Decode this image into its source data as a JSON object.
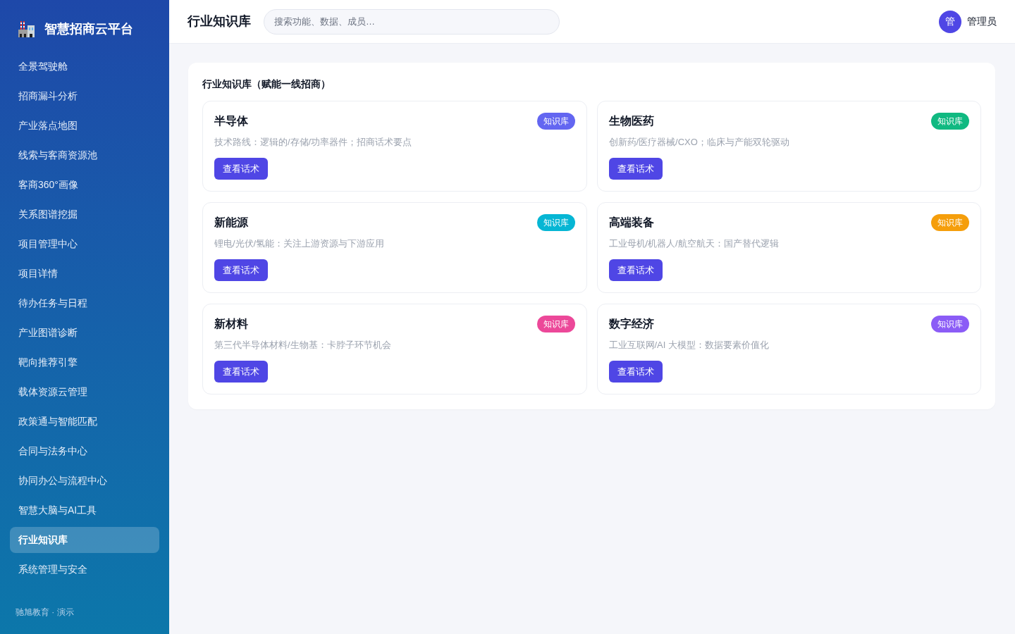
{
  "sidebar": {
    "logo_text": "智慧招商云平台",
    "items": [
      {
        "label": "全景驾驶舱",
        "selected": false
      },
      {
        "label": "招商漏斗分析",
        "selected": false
      },
      {
        "label": "产业落点地图",
        "selected": false
      },
      {
        "label": "线索与客商资源池",
        "selected": false
      },
      {
        "label": "客商360°画像",
        "selected": false
      },
      {
        "label": "关系图谱挖掘",
        "selected": false
      },
      {
        "label": "项目管理中心",
        "selected": false
      },
      {
        "label": "项目详情",
        "selected": false
      },
      {
        "label": "待办任务与日程",
        "selected": false
      },
      {
        "label": "产业图谱诊断",
        "selected": false
      },
      {
        "label": "靶向推荐引擎",
        "selected": false
      },
      {
        "label": "载体资源云管理",
        "selected": false
      },
      {
        "label": "政策通与智能匹配",
        "selected": false
      },
      {
        "label": "合同与法务中心",
        "selected": false
      },
      {
        "label": "协同办公与流程中心",
        "selected": false
      },
      {
        "label": "智慧大脑与AI工具",
        "selected": false
      },
      {
        "label": "行业知识库",
        "selected": true
      },
      {
        "label": "系统管理与安全",
        "selected": false
      }
    ],
    "footer": "驰旭教育 · 演示"
  },
  "header": {
    "title": "行业知识库",
    "search": {
      "placeholder": "搜索功能、数据、成员…"
    },
    "user": {
      "avatar": "管",
      "name": "管理员"
    }
  },
  "panel": {
    "title": "行业知识库（赋能一线招商）",
    "cards": [
      {
        "title": "半导体",
        "badge": "知识库",
        "color": "#6366f1",
        "description": "技术路线：逻辑的/存储/功率器件；招商话术要点",
        "button": "查看话术"
      },
      {
        "title": "生物医药",
        "badge": "知识库",
        "color": "#10b981",
        "description": "创新药/医疗器械/CXO；临床与产能双轮驱动",
        "button": "查看话术"
      },
      {
        "title": "新能源",
        "badge": "知识库",
        "color": "#06b6d4",
        "description": "锂电/光伏/氢能：关注上游资源与下游应用",
        "button": "查看话术"
      },
      {
        "title": "高端装备",
        "badge": "知识库",
        "color": "#f59e0b",
        "description": "工业母机/机器人/航空航天：国产替代逻辑",
        "button": "查看话术"
      },
      {
        "title": "新材料",
        "badge": "知识库",
        "color": "#ec4899",
        "description": "第三代半导体材料/生物基：卡脖子环节机会",
        "button": "查看话术"
      },
      {
        "title": "数字经济",
        "badge": "知识库",
        "color": "#8b5cf6",
        "description": "工业互联网/AI 大模型：数据要素价值化",
        "button": "查看话术"
      }
    ]
  }
}
